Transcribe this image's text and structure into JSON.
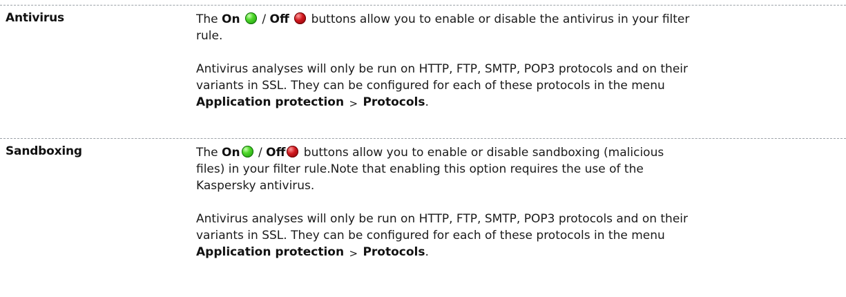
{
  "rows": [
    {
      "term": "Antivirus",
      "p1": {
        "t1": "The ",
        "on": "On",
        "slash": "/",
        "off": "Off",
        "t2": " buttons allow you to enable or disable the antivirus in your filter rule."
      },
      "p2": {
        "t1": "Antivirus analyses will only be run on HTTP, FTP, SMTP, POP3 protocols and on their variants in SSL. They can be configured for each of these protocols in the menu ",
        "menu1": "Application protection",
        "sep": ">",
        "menu2": "Protocols",
        "end": "."
      }
    },
    {
      "term": "Sandboxing",
      "p1": {
        "t1": "The ",
        "on": "On",
        "slash": "/",
        "off": "Off",
        "t2": " buttons allow you to enable or disable sandboxing (malicious files) in your filter rule.Note that enabling this option requires the use of the Kaspersky antivirus."
      },
      "p2": {
        "t1": "Antivirus analyses will only be run on HTTP, FTP, SMTP, POP3 protocols and on their variants in SSL. They can be configured for each of these protocols in the menu ",
        "menu1": "Application protection",
        "sep": ">",
        "menu2": "Protocols",
        "end": "."
      }
    }
  ],
  "icons": {
    "on": "green-dot-icon",
    "off": "red-dot-icon"
  },
  "colors": {
    "on": "#2fbf14",
    "off": "#c0141a",
    "separator": "#9aa0a6"
  }
}
